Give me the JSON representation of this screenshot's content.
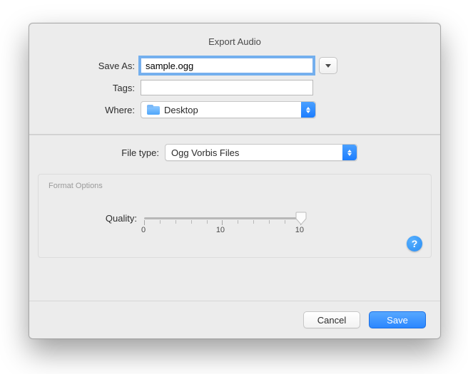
{
  "title": "Export Audio",
  "labels": {
    "save_as": "Save As:",
    "tags": "Tags:",
    "where": "Where:",
    "file_type": "File type:",
    "format_options": "Format Options",
    "quality": "Quality:"
  },
  "inputs": {
    "save_as_value": "sample.ogg",
    "tags_value": ""
  },
  "where": {
    "selected": "Desktop"
  },
  "file_type": {
    "selected": "Ogg Vorbis Files"
  },
  "quality": {
    "min": 0,
    "max": 10,
    "value": 10,
    "tick_labels": [
      "0",
      "10",
      "10"
    ]
  },
  "buttons": {
    "cancel": "Cancel",
    "save": "Save"
  },
  "help_glyph": "?"
}
